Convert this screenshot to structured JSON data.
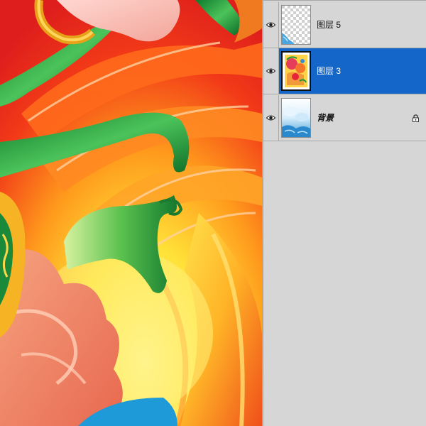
{
  "layers": [
    {
      "name": "图层 5",
      "visible": true,
      "selected": false,
      "locked": false,
      "thumbnail": "transparent-checker-with-blue-corner",
      "eye_icon": "eye-icon"
    },
    {
      "name": "图层 3",
      "visible": true,
      "selected": true,
      "locked": false,
      "thumbnail": "colorful-artwork",
      "eye_icon": "eye-icon"
    },
    {
      "name": "背景",
      "visible": true,
      "selected": false,
      "locked": true,
      "thumbnail": "blue-white-splash",
      "eye_icon": "eye-icon",
      "lock_icon": "lock-icon"
    }
  ],
  "colors": {
    "selection": "#1467c8",
    "panel_bg": "#d6d6d6",
    "artwork_red": "#e8261c",
    "artwork_yellow": "#ffe54a",
    "artwork_green": "#1f9a3a"
  }
}
